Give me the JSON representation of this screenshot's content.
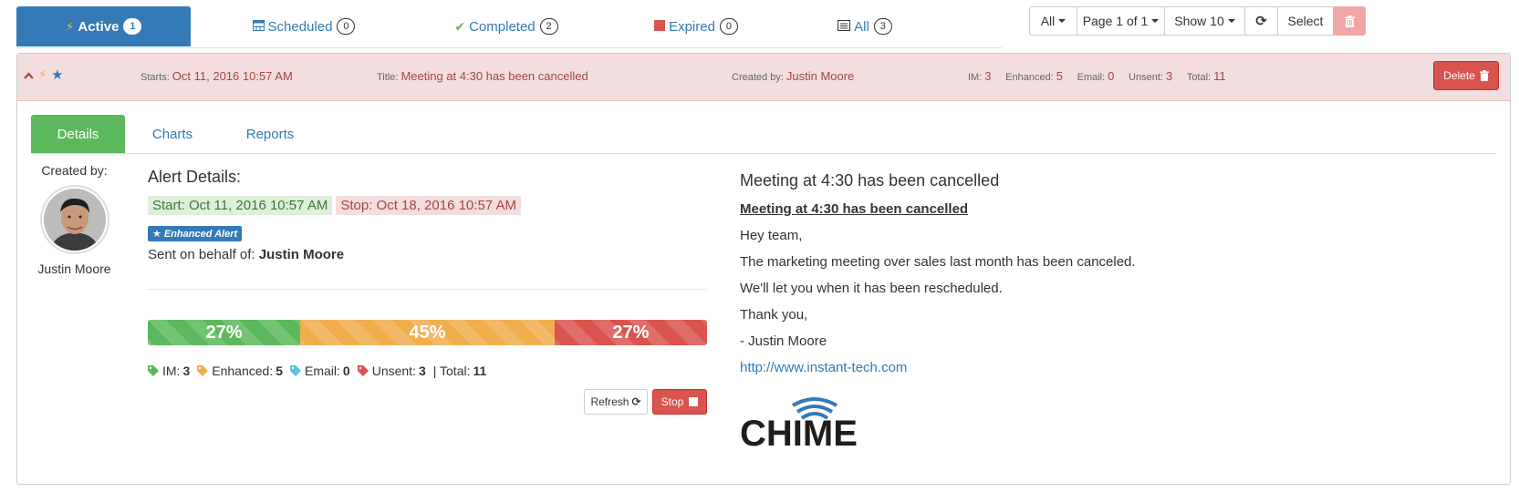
{
  "status_tabs": [
    {
      "label": "Active",
      "count": "1",
      "icon": "bolt-icon"
    },
    {
      "label": "Scheduled",
      "count": "0",
      "icon": "calendar-icon"
    },
    {
      "label": "Completed",
      "count": "2",
      "icon": "check-icon"
    },
    {
      "label": "Expired",
      "count": "0",
      "icon": "stop-square-icon"
    },
    {
      "label": "All",
      "count": "3",
      "icon": "list-icon"
    }
  ],
  "toolbar": {
    "filter": "All",
    "page": "Page 1 of 1",
    "show": "Show 10",
    "select": "Select",
    "refresh_icon": "refresh-icon",
    "trash_icon": "trash-icon"
  },
  "summary": {
    "starts_label": "Starts:",
    "starts_value": "Oct 11, 2016 10:57 AM",
    "title_label": "Title:",
    "title_value": "Meeting at 4:30 has been cancelled",
    "created_label": "Created by:",
    "created_value": "Justin Moore",
    "im_label": "IM:",
    "im_value": "3",
    "enhanced_label": "Enhanced:",
    "enhanced_value": "5",
    "email_label": "Email:",
    "email_value": "0",
    "unsent_label": "Unsent:",
    "unsent_value": "3",
    "total_label": "Total:",
    "total_value": "11",
    "delete_label": "Delete"
  },
  "inner_tabs": [
    "Details",
    "Charts",
    "Reports"
  ],
  "creator": {
    "label": "Created by:",
    "name": "Justin Moore"
  },
  "details": {
    "heading": "Alert Details:",
    "start": "Start: Oct 11, 2016 10:57 AM",
    "stop": "Stop: Oct 18, 2016 10:57 AM",
    "badge": "Enhanced Alert",
    "behalf_label": "Sent on behalf of:",
    "behalf_name": "Justin Moore"
  },
  "progress": [
    {
      "label": "27%",
      "fraction": 0.27,
      "color": "#5cb85c"
    },
    {
      "label": "45%",
      "fraction": 0.45,
      "color": "#f0ad4e"
    },
    {
      "label": "27%",
      "fraction": 0.27,
      "color": "#d9534f"
    }
  ],
  "legend": {
    "im_label": "IM:",
    "im": "3",
    "enhanced_label": "Enhanced:",
    "enhanced": "5",
    "email_label": "Email:",
    "email": "0",
    "unsent_label": "Unsent:",
    "unsent": "3",
    "total_label": "| Total:",
    "total": "11"
  },
  "buttons": {
    "refresh": "Refresh",
    "stop": "Stop"
  },
  "message": {
    "title": "Meeting at 4:30 has been cancelled",
    "headline": "Meeting at 4:30 has been cancelled",
    "lines": [
      "Hey team,",
      "The marketing meeting over sales last month has been canceled.",
      "We'll let you when it has been rescheduled.",
      "Thank you,",
      "- Justin Moore"
    ],
    "link": "http://www.instant-tech.com",
    "logo_text": "CHIME"
  },
  "colors": {
    "primary": "#337ab7",
    "success": "#5cb85c",
    "warning": "#f0ad4e",
    "danger": "#d9534f",
    "danger_bg": "#f2dede"
  }
}
